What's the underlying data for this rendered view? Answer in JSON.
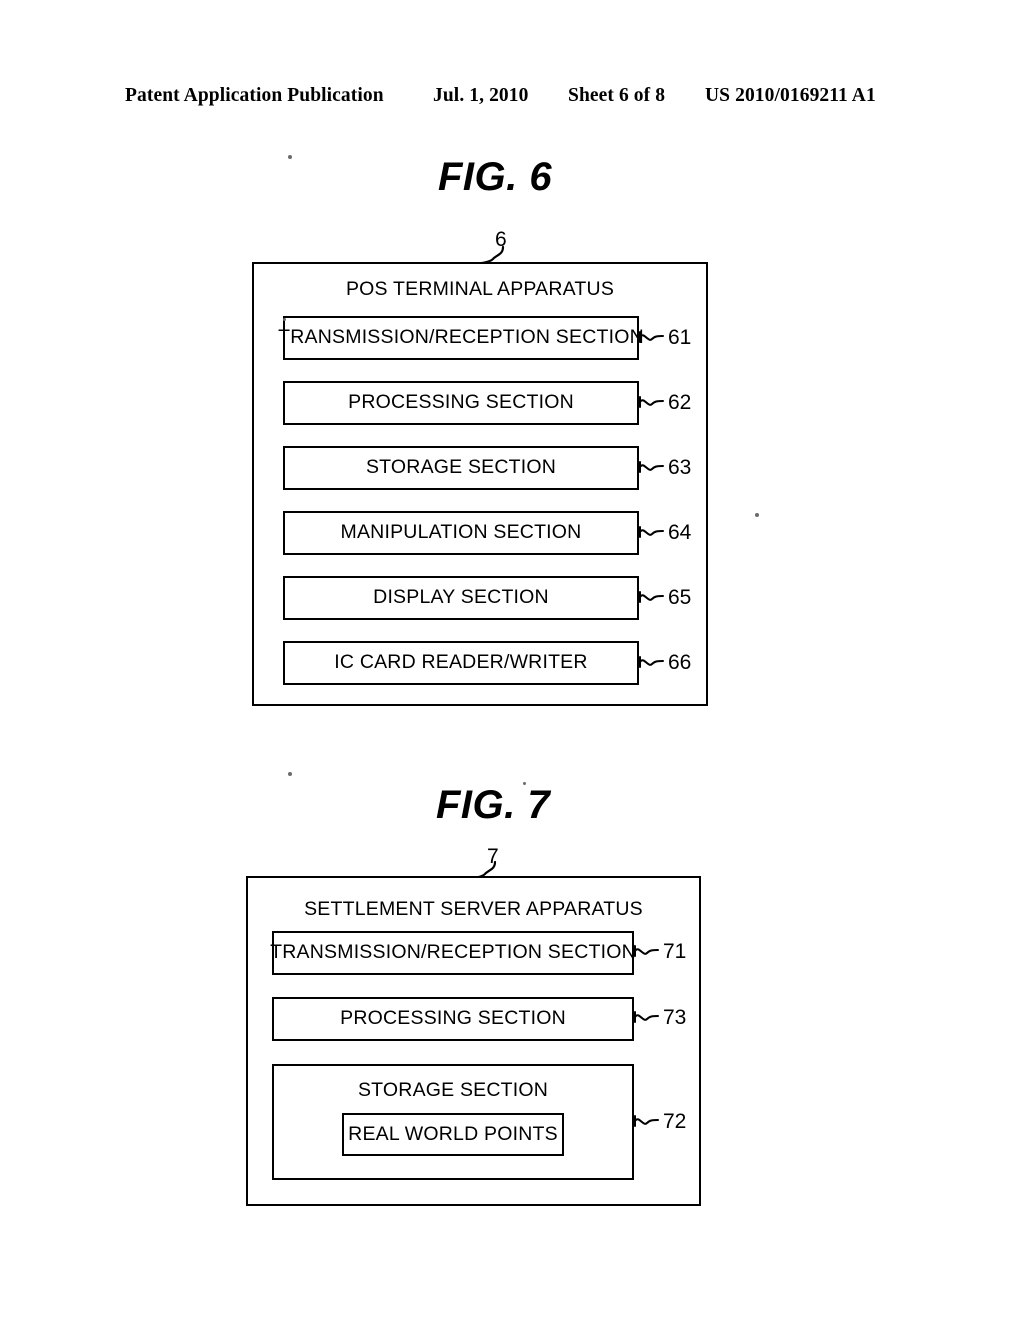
{
  "header": {
    "publication": "Patent Application Publication",
    "date": "Jul. 1, 2010",
    "sheet": "Sheet 6 of 8",
    "patent_number": "US 2010/0169211 A1"
  },
  "figures": [
    {
      "title": "FIG. 6",
      "reference": "6",
      "apparatus_title": "POS TERMINAL APPARATUS",
      "modules": [
        {
          "label": "TRANSMISSION/RECEPTION SECTION",
          "ref": "61"
        },
        {
          "label": "PROCESSING SECTION",
          "ref": "62"
        },
        {
          "label": "STORAGE SECTION",
          "ref": "63"
        },
        {
          "label": "MANIPULATION SECTION",
          "ref": "64"
        },
        {
          "label": "DISPLAY SECTION",
          "ref": "65"
        },
        {
          "label": "IC CARD READER/WRITER",
          "ref": "66"
        }
      ]
    },
    {
      "title": "FIG. 7",
      "reference": "7",
      "apparatus_title": "SETTLEMENT SERVER APPARATUS",
      "modules": [
        {
          "label": "TRANSMISSION/RECEPTION SECTION",
          "ref": "71"
        },
        {
          "label": "PROCESSING SECTION",
          "ref": "73"
        },
        {
          "label": "STORAGE SECTION",
          "ref": "72",
          "nested": {
            "label": "REAL WORLD POINTS"
          }
        }
      ]
    }
  ]
}
